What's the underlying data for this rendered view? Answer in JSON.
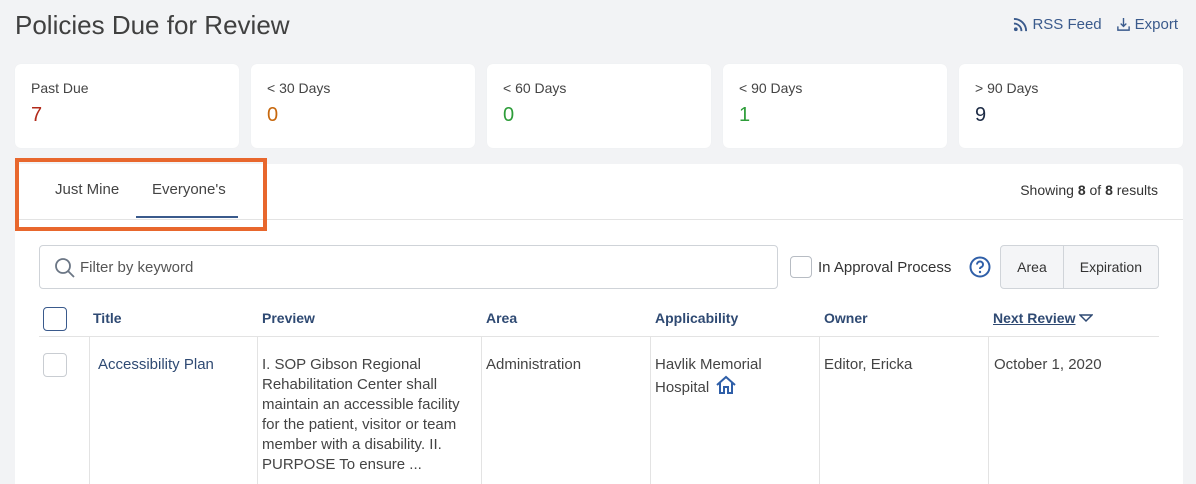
{
  "page": {
    "title": "Policies Due for Review"
  },
  "actions": {
    "rss": "RSS Feed",
    "export": "Export"
  },
  "cards": [
    {
      "label": "Past Due",
      "value": "7",
      "color": "#b22a1a"
    },
    {
      "label": "< 30 Days",
      "value": "0",
      "color": "#c7680e"
    },
    {
      "label": "< 60 Days",
      "value": "0",
      "color": "#2e9d3a"
    },
    {
      "label": "< 90 Days",
      "value": "1",
      "color": "#2e9d3a"
    },
    {
      "label": "> 90 Days",
      "value": "9",
      "color": "#1c2a44"
    }
  ],
  "tabs": {
    "just_mine": "Just Mine",
    "everyones": "Everyone's"
  },
  "showing": {
    "prefix": "Showing",
    "count": "8",
    "of": "of",
    "total": "8",
    "suffix": "results"
  },
  "filter": {
    "placeholder": "Filter by keyword",
    "approval_label": "In Approval Process"
  },
  "sort_buttons": {
    "area": "Area",
    "expiration": "Expiration"
  },
  "table": {
    "headers": {
      "title": "Title",
      "preview": "Preview",
      "area": "Area",
      "applicability": "Applicability",
      "owner": "Owner",
      "next_review": "Next Review"
    },
    "rows": [
      {
        "title": "Accessibility Plan",
        "preview": "I. SOP Gibson Regional Rehabilitation Center shall maintain an accessible facility for the patient, visitor or team member with a disability. II. PURPOSE To ensure ...",
        "area": "Administration",
        "applicability": "Havlik Memorial Hospital",
        "owner": "Editor, Ericka",
        "next_review": "October 1, 2020"
      }
    ]
  },
  "colors": {
    "accent": "#3a5a8c",
    "highlight": "#e8672d"
  }
}
